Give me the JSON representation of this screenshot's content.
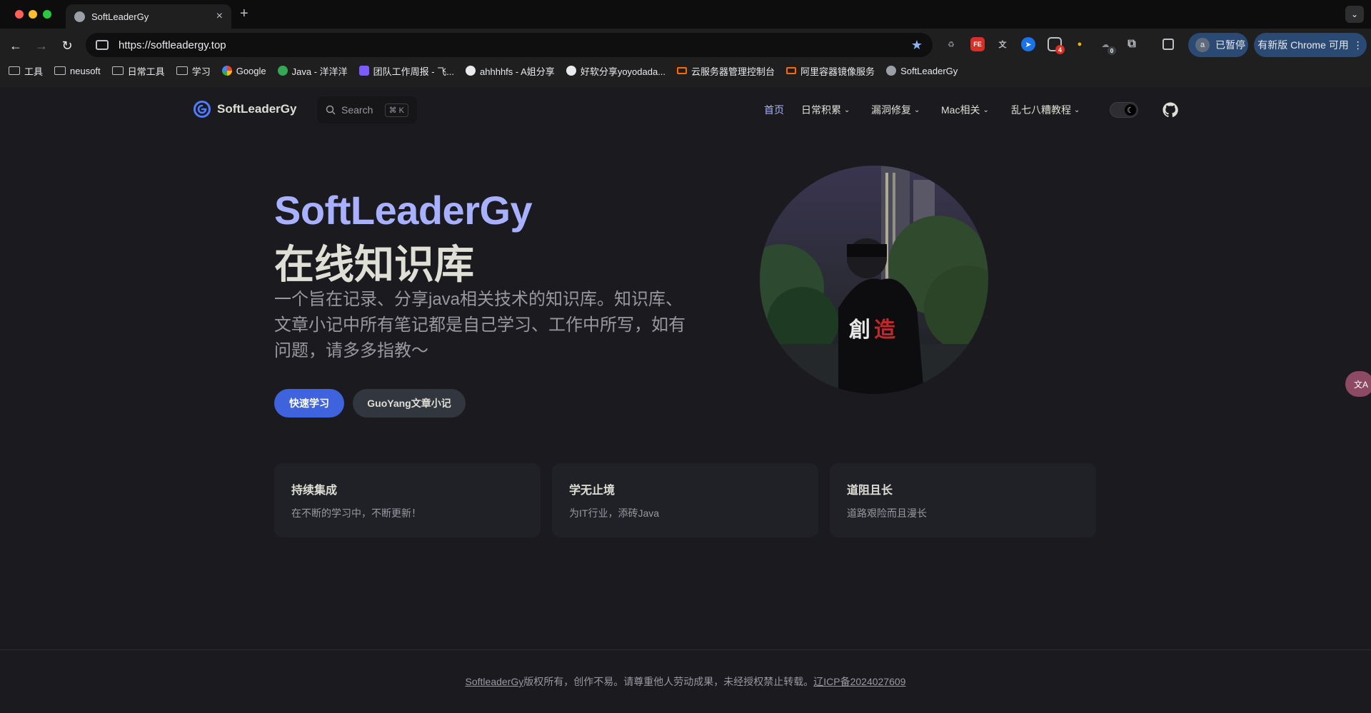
{
  "browser": {
    "tab_title": "SoftLeaderGy",
    "tab_close": "×",
    "new_tab": "+",
    "tab_menu": "⌄",
    "url": "https://softleadergy.top",
    "bookmark_star": "★",
    "ext_fe": "FE",
    "ext_badge_4": "4",
    "ext_badge_0": "0",
    "paused_avatar": "a",
    "paused_label": "已暂停",
    "update_label": "有新版 Chrome 可用",
    "update_more": "⋮",
    "bookmarks": [
      {
        "label": "工具",
        "icon": "folder"
      },
      {
        "label": "neusoft",
        "icon": "folder"
      },
      {
        "label": "日常工具",
        "icon": "folder"
      },
      {
        "label": "学习",
        "icon": "folder"
      },
      {
        "label": "Google",
        "icon": "google"
      },
      {
        "label": "Java - 洋洋洋",
        "icon": "site"
      },
      {
        "label": "团队工作周报 - 飞...",
        "icon": "feishu"
      },
      {
        "label": "ahhhhfs - A姐分享",
        "icon": "avatar"
      },
      {
        "label": "好软分享yoyodada...",
        "icon": "avatar"
      },
      {
        "label": "云服务器管理控制台",
        "icon": "aliyun"
      },
      {
        "label": "阿里容器镜像服务",
        "icon": "aliyun"
      },
      {
        "label": "SoftLeaderGy",
        "icon": "globe"
      }
    ]
  },
  "nav": {
    "brand": "SoftLeaderGy",
    "search_placeholder": "Search",
    "search_kbd": "⌘ K",
    "menu": [
      {
        "label": "首页",
        "active": true
      },
      {
        "label": "日常积累",
        "dropdown": true
      },
      {
        "label": "漏洞修复",
        "dropdown": true
      },
      {
        "label": "Mac相关",
        "dropdown": true
      },
      {
        "label": "乱七八糟教程",
        "dropdown": true
      }
    ],
    "chevron": "⌄",
    "theme_icon": "☾"
  },
  "hero": {
    "name": "SoftLeaderGy",
    "text": "在线知识库",
    "tagline": "一个旨在记录、分享java相关技术的知识库。知识库、文章小记中所有笔记都是自己学习、工作中所写，如有问题，请多多指教～",
    "primary_action": "快速学习",
    "secondary_action": "GuoYang文章小记"
  },
  "features": [
    {
      "title": "持续集成",
      "details": "在不断的学习中，不断更新！"
    },
    {
      "title": "学无止境",
      "details": "为IT行业，添砖Java"
    },
    {
      "title": "道阻且长",
      "details": "道路艰险而且漫长"
    }
  ],
  "side_badge": "文A",
  "footer": {
    "owner_link": "SoftleaderGy",
    "copyright": "版权所有，创作不易。请尊重他人劳动成果，未经授权禁止转载。",
    "icp": "辽ICP备2024027609"
  },
  "colors": {
    "brand_accent": "#a8b1ff",
    "primary_button": "#3e63dd",
    "page_bg": "#1b1b1f"
  }
}
